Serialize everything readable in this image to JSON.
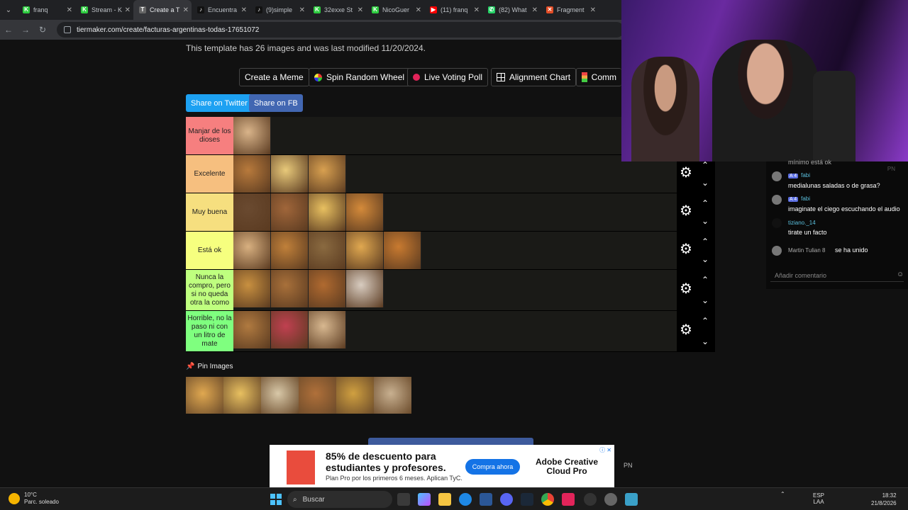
{
  "browser": {
    "tabs": [
      {
        "label": "franq",
        "color": "#2ecc40",
        "glyph": "K",
        "active": false
      },
      {
        "label": "Stream - K",
        "color": "#2ecc40",
        "glyph": "K",
        "active": false
      },
      {
        "label": "Create a T",
        "color": "#666666",
        "glyph": "T",
        "active": true
      },
      {
        "label": "Encuentra",
        "color": "#111111",
        "glyph": "♪",
        "active": false
      },
      {
        "label": "(9)simple",
        "color": "#111111",
        "glyph": "♪",
        "active": false
      },
      {
        "label": "32exxe St",
        "color": "#2ecc40",
        "glyph": "K",
        "active": false
      },
      {
        "label": "NicoGuer",
        "color": "#2ecc40",
        "glyph": "K",
        "active": false
      },
      {
        "label": "(11) franq",
        "color": "#ff0000",
        "glyph": "▶",
        "active": false
      },
      {
        "label": "(82) What",
        "color": "#25d366",
        "glyph": "✆",
        "active": false
      },
      {
        "label": "Fragment",
        "color": "#e44d26",
        "glyph": "✕",
        "active": false
      }
    ],
    "url": "tiermaker.com/create/facturas-argentinas-todas-17651072"
  },
  "page": {
    "template_info": "This template has 26 images and was last modified 11/20/2024.",
    "buttons": {
      "create_meme": "Create a Meme",
      "spin_wheel": "Spin Random Wheel",
      "live_poll": "Live Voting Poll",
      "alignment": "Alignment Chart",
      "community": "Comm"
    },
    "share": {
      "twitter": "Share on Twitter",
      "fb": "Share on FB"
    },
    "tiers": [
      {
        "label": "Manjar de los dioses",
        "color": "#f67f7f",
        "items": [
          "#d9b48a"
        ]
      },
      {
        "label": "Excelente",
        "color": "#f6bf7f",
        "items": [
          "#b87a3c",
          "#e8c97a",
          "#d8a050"
        ]
      },
      {
        "label": "Muy buena",
        "color": "#f6df7f",
        "items": [
          "#6a4a30",
          "#a0663a",
          "#e8c060",
          "#d48a3a"
        ]
      },
      {
        "label": "Está ok",
        "color": "#f6ff7f",
        "items": [
          "#d8b080",
          "#c0803a",
          "#8a6a40",
          "#e0a850",
          "#c87a30"
        ]
      },
      {
        "label": "Nunca la compro, pero si no queda otra la como",
        "color": "#bfff7f",
        "items": [
          "#c89040",
          "#a8703a",
          "#b06a30",
          "#d8ccc0"
        ]
      },
      {
        "label": "Horrible, no la paso ni con un litro de mate",
        "color": "#7fff7f",
        "items": [
          "#b07a40",
          "#c04050",
          "#d8b890"
        ]
      }
    ],
    "pin_title": "Pin Images",
    "pin_items": [
      "#e0a850",
      "#e8c060",
      "#d8c8a8",
      "#b0703a",
      "#d0a040",
      "#c8b090"
    ]
  },
  "ad": {
    "headline": "85% de descuento para estudiantes y profesores.",
    "sub": "Plan Pro por los primeros 6 meses. Aplican TyC.",
    "cta": "Compra ahora",
    "brand": "Adobe Creative Cloud Pro"
  },
  "overlay_pn": "PN",
  "chat": {
    "top_partial": "mínimo está ok",
    "messages": [
      {
        "user": "fabi",
        "badge": "A 4",
        "text": "medialunas saladas o de grasa?"
      },
      {
        "user": "fabi",
        "badge": "A 4",
        "text": "imaginate el ciego escuchando el audio"
      },
      {
        "user": "tiziano._14",
        "badge": "",
        "text": "tirate un facto"
      }
    ],
    "join_user": "Martin Tulian 8",
    "join_text": "se ha unido",
    "input_placeholder": "Añadir comentario"
  },
  "taskbar": {
    "temp": "10°C",
    "weather": "Parc. soleado",
    "search": "Buscar",
    "lang1": "ESP",
    "lang2": "LAA",
    "time": "18:32",
    "date": "21/8/2026"
  }
}
